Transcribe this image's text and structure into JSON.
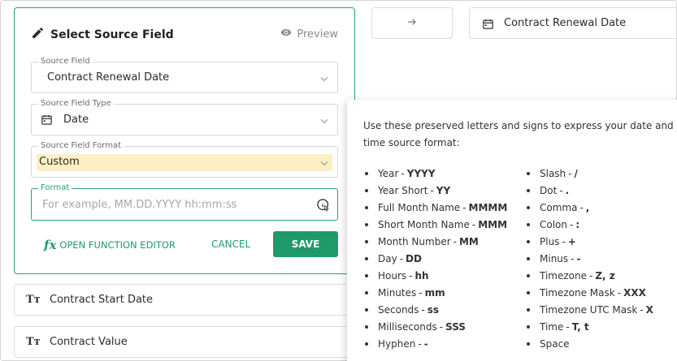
{
  "editor": {
    "title": "Select Source Field",
    "preview_label": "Preview",
    "source_field": {
      "label": "Source Field",
      "value": "Contract Renewal Date"
    },
    "source_field_type": {
      "label": "Source Field Type",
      "value": "Date"
    },
    "source_field_format": {
      "label": "Source Field Format",
      "value": "Custom"
    },
    "format": {
      "label": "Format",
      "value": "",
      "placeholder": "For example, MM.DD.YYYY hh:mm:ss"
    },
    "function_editor_label": "OPEN FUNCTION EDITOR",
    "cancel_label": "CANCEL",
    "save_label": "SAVE"
  },
  "fields": [
    {
      "label": "Contract Start Date"
    },
    {
      "label": "Contract Value"
    }
  ],
  "mapping": {
    "target_label": "Contract Renewal Date"
  },
  "help": {
    "intro": "Use these preserved letters and signs to express your date and time source format:",
    "col1": [
      {
        "name": "Year",
        "token": "YYYY"
      },
      {
        "name": "Year Short",
        "token": "YY"
      },
      {
        "name": "Full Month Name",
        "token": "MMMM"
      },
      {
        "name": "Short Month Name",
        "token": "MMM"
      },
      {
        "name": "Month Number",
        "token": "MM"
      },
      {
        "name": "Day",
        "token": "DD"
      },
      {
        "name": "Hours",
        "token": "hh"
      },
      {
        "name": "Minutes",
        "token": "mm"
      },
      {
        "name": "Seconds",
        "token": "ss"
      },
      {
        "name": "Milliseconds",
        "token": "SSS"
      },
      {
        "name": "Hyphen",
        "token": "-"
      }
    ],
    "col2": [
      {
        "name": "Slash",
        "token": "/"
      },
      {
        "name": "Dot",
        "token": "."
      },
      {
        "name": "Comma",
        "token": ","
      },
      {
        "name": "Colon",
        "token": ":"
      },
      {
        "name": "Plus",
        "token": "+"
      },
      {
        "name": "Minus",
        "token": "-"
      },
      {
        "name": "Timezone",
        "token": "Z, z"
      },
      {
        "name": "Timezone Mask",
        "token": "XXX"
      },
      {
        "name": "Timezone UTC Mask",
        "token": "X"
      },
      {
        "name": "Time",
        "token": "T, t"
      },
      {
        "name": "Space",
        "token": ""
      }
    ]
  },
  "colors": {
    "accent": "#1f9a6a",
    "highlight": "#fcefc4"
  }
}
